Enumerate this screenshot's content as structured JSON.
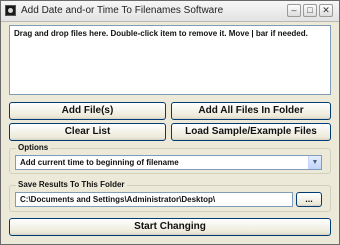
{
  "window": {
    "title": "Add Date and-or Time To Filenames Software",
    "minimize_glyph": "–",
    "maximize_glyph": "□",
    "close_glyph": "✕"
  },
  "file_list": {
    "instruction": "Drag and drop files here. Double-click item to remove it. Move | bar if needed."
  },
  "buttons": {
    "add_files": "Add File(s)",
    "add_folder": "Add All Files In Folder",
    "clear_list": "Clear List",
    "load_sample": "Load Sample/Example Files",
    "browse": "...",
    "start": "Start Changing"
  },
  "options": {
    "legend": "Options",
    "selected": "Add current time to beginning of filename",
    "arrow": "▼"
  },
  "save": {
    "legend": "Save Results To This Folder",
    "path": "C:\\Documents and Settings\\Administrator\\Desktop\\"
  }
}
